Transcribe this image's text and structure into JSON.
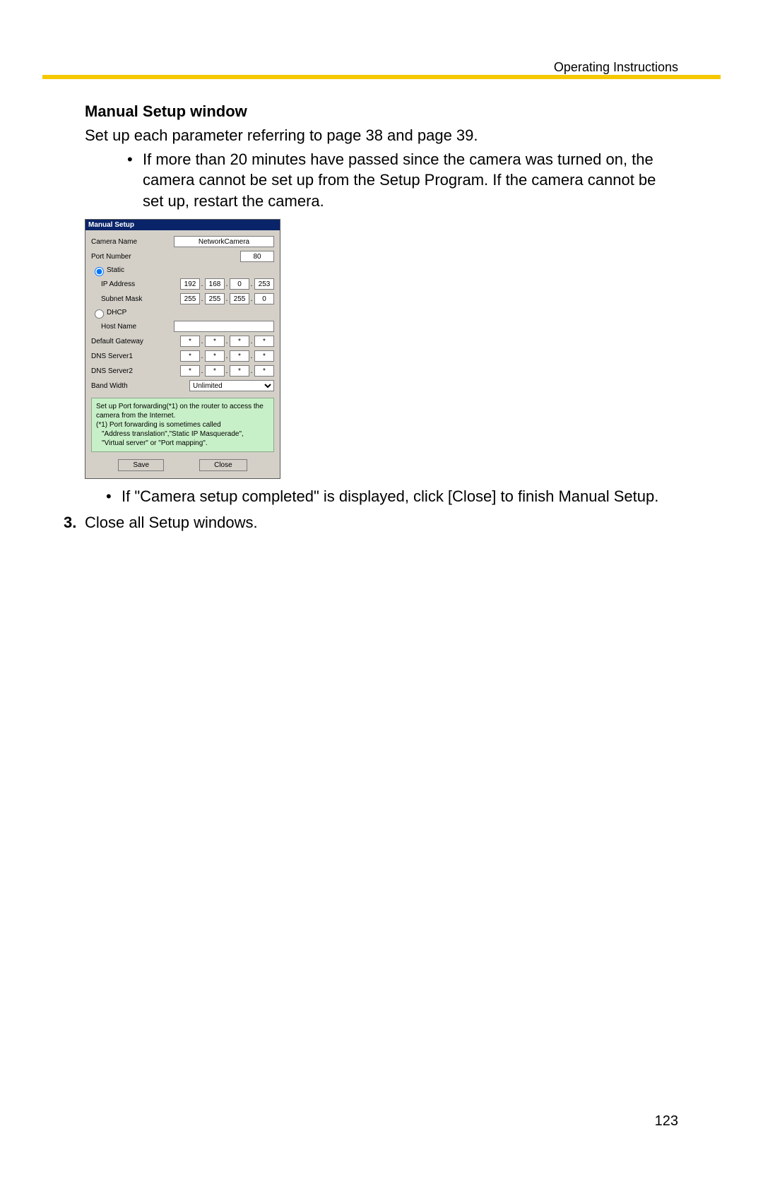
{
  "header": {
    "running": "Operating Instructions"
  },
  "section_title": "Manual Setup window",
  "intro": "Set up each parameter referring to page 38 and page 39.",
  "bullets_top": [
    "If more than 20 minutes have passed since the camera was turned on, the camera cannot be set up from the Setup Program. If the camera cannot be set up, restart the camera."
  ],
  "bullets_bottom": [
    "If \"Camera setup completed\" is displayed, click [Close] to finish Manual Setup."
  ],
  "step3_num": "3.",
  "step3_text": "Close all Setup windows.",
  "page_number": "123",
  "dialog": {
    "title": "Manual Setup",
    "labels": {
      "camera_name": "Camera Name",
      "port_number": "Port Number",
      "static": "Static",
      "ip_address": "IP Address",
      "subnet_mask": "Subnet Mask",
      "dhcp": "DHCP",
      "host_name": "Host Name",
      "default_gateway": "Default Gateway",
      "dns1": "DNS Server1",
      "dns2": "DNS Server2",
      "band_width": "Band Width"
    },
    "values": {
      "camera_name": "NetworkCamera",
      "port": "80",
      "ip": [
        "192",
        "168",
        "0",
        "253"
      ],
      "subnet": [
        "255",
        "255",
        "255",
        "0"
      ],
      "host_name": "",
      "gw": [
        "*",
        "*",
        "*",
        "*"
      ],
      "dns1": [
        "*",
        "*",
        "*",
        "*"
      ],
      "dns2": [
        "*",
        "*",
        "*",
        "*"
      ],
      "band_width": "Unlimited"
    },
    "note": {
      "l1": "Set up Port forwarding(*1) on the router to access the camera from the Internet.",
      "l2": "(*1) Port forwarding is sometimes called",
      "l3": "\"Address translation\",\"Static IP Masquerade\",",
      "l4": "\"Virtual server\" or \"Port mapping\"."
    },
    "buttons": {
      "save": "Save",
      "close": "Close"
    }
  }
}
